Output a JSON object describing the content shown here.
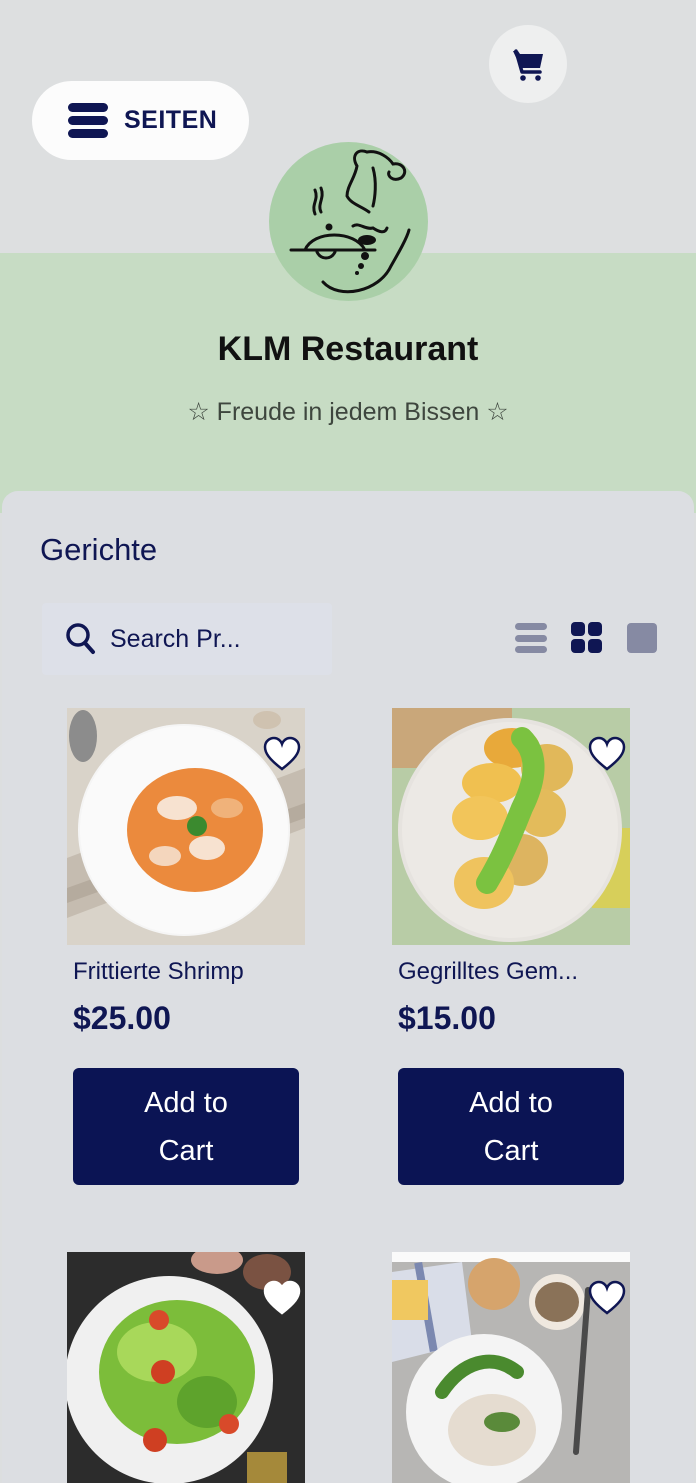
{
  "header": {
    "pages_label": "SEITEN",
    "restaurant_name": "KLM Restaurant",
    "tagline": "☆ Freude in jedem Bissen ☆"
  },
  "main": {
    "section_title": "Gerichte",
    "search": {
      "placeholder": "Search Pr..."
    },
    "view_options": [
      "list",
      "grid",
      "single"
    ],
    "active_view": "grid",
    "products": [
      {
        "name": "Frittierte Shrimp",
        "price": "$25.00",
        "button": "Add to Cart",
        "image": "fried shrimp on white plate"
      },
      {
        "name": "Gegrilltes Gem...",
        "price": "$15.00",
        "button": "Add to Cart",
        "image": "grilled vegetables with pesto"
      },
      {
        "name": "",
        "price": "",
        "button": "",
        "image": "green salad with tomatoes"
      },
      {
        "name": "",
        "price": "",
        "button": "",
        "image": "risotto with greens and mushrooms"
      }
    ]
  },
  "colors": {
    "brand_navy": "#0f1653",
    "button_bg": "#0b1454",
    "header_green": "#c7dcc4",
    "logo_green": "#aacfa8",
    "panel_bg": "#dcdee2",
    "inactive_icon": "#868aa3"
  }
}
